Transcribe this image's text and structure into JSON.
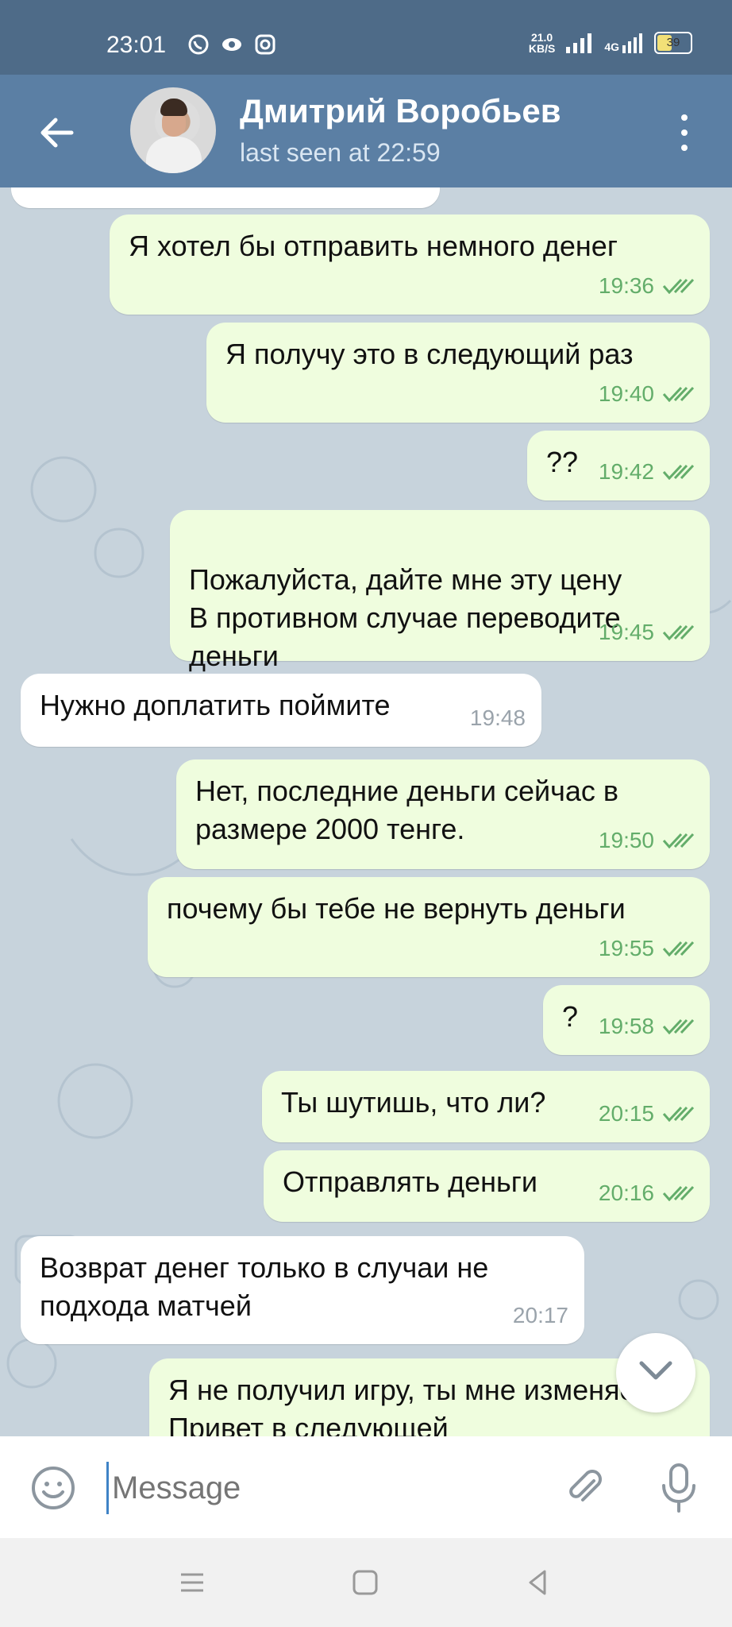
{
  "status_bar": {
    "time": "23:01",
    "speed_value": "21.0",
    "speed_unit": "KB/S",
    "network": "4G",
    "battery": "39",
    "icons": [
      "whatsapp-icon",
      "eye-icon",
      "instagram-icon",
      "signal-icon",
      "battery-icon"
    ]
  },
  "header": {
    "contact_name": "Дмитрий Воробьев",
    "last_seen": "last seen at 22:59",
    "accent": "#5b7fa4"
  },
  "messages": [
    {
      "direction": "out",
      "text": "Я хотел бы отправить немного денег",
      "time": "19:36"
    },
    {
      "direction": "out",
      "text": "Я получу это в следующий раз",
      "time": "19:40"
    },
    {
      "direction": "out",
      "text": "??",
      "time": "19:42"
    },
    {
      "direction": "out",
      "text": "Пожалуйста, дайте мне эту цену\nВ противном случае переводите деньги",
      "time": "19:45"
    },
    {
      "direction": "in",
      "text": "Нужно доплатить поймите",
      "time": "19:48"
    },
    {
      "direction": "out",
      "text": "Нет, последние деньги сейчас в размере 2000 тенге.",
      "time": "19:50"
    },
    {
      "direction": "out",
      "text": "почему бы тебе не вернуть деньги",
      "time": "19:55"
    },
    {
      "direction": "out",
      "text": "?",
      "time": "19:58"
    },
    {
      "direction": "out",
      "text": "Ты шутишь, что ли?",
      "time": "20:15"
    },
    {
      "direction": "out",
      "text": "Отправлять деньги",
      "time": "20:16"
    },
    {
      "direction": "in",
      "text": "Возврат денег только в случаи не подхода матчей",
      "time": "20:17"
    },
    {
      "direction": "out",
      "text": "Я не получил игру, ты мне изменяешь. Привет в следующей",
      "time": ""
    }
  ],
  "input": {
    "placeholder": "Message"
  },
  "colors": {
    "outgoing_bubble": "#effdde",
    "incoming_bubble": "#ffffff",
    "read_ticks": "#63ad6a"
  }
}
